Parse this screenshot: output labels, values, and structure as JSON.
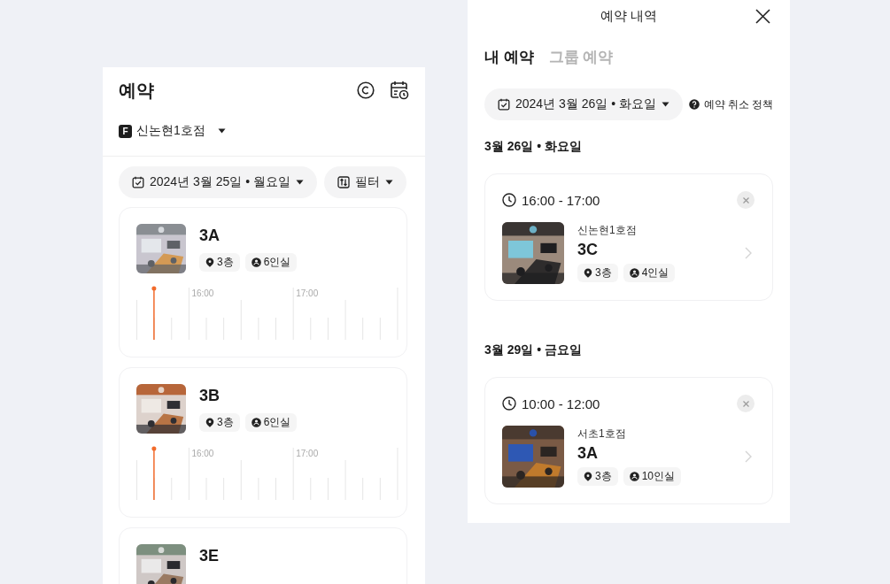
{
  "booking_screen": {
    "title": "예약",
    "branch": {
      "badge": "F",
      "name": "신논현1호점"
    },
    "date": "2024년 3월 25일 • 월요일",
    "filter": "필터",
    "rooms": [
      {
        "name": "3A",
        "floor": "3층",
        "capacity": "6인실",
        "timeline": {
          "hours": [
            "16:00",
            "17:00"
          ],
          "now": {
            "level": 0.065
          }
        }
      },
      {
        "name": "3B",
        "floor": "3층",
        "capacity": "6인실",
        "timeline": {
          "hours": [
            "16:00",
            "17:00"
          ],
          "now": {
            "level": 0.065
          }
        }
      },
      {
        "name": "3E"
      }
    ]
  },
  "history_panel": {
    "title": "예약 내역",
    "tabs": [
      {
        "label": "내 예약",
        "selected": true
      },
      {
        "label": "그룹 예약",
        "selected": false
      }
    ],
    "date": "2024년 3월 26일 • 화요일",
    "policy": "예약 취소 정책",
    "days": [
      {
        "heading": "3월 26일 • 화요일",
        "bookings": [
          {
            "time": "16:00 - 17:00",
            "branch": "신논현1호점",
            "room": "3C",
            "floor": "3층",
            "capacity": "4인실"
          }
        ]
      },
      {
        "heading": "3월 29일 • 금요일",
        "bookings": [
          {
            "time": "10:00 - 12:00",
            "branch": "서초1호점",
            "room": "3A",
            "floor": "3층",
            "capacity": "10인실"
          }
        ]
      }
    ]
  }
}
